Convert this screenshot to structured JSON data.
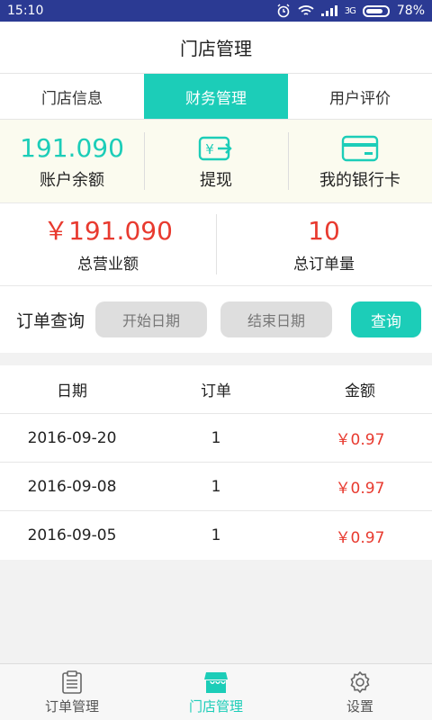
{
  "status_bar": {
    "time": "15:10",
    "network": "3G",
    "battery": "78%"
  },
  "header": {
    "title": "门店管理"
  },
  "tabs": [
    {
      "label": "门店信息",
      "active": false
    },
    {
      "label": "财务管理",
      "active": true
    },
    {
      "label": "用户评价",
      "active": false
    }
  ],
  "balance": {
    "amount": "191.090",
    "amount_label": "账户余额",
    "withdraw_label": "提现",
    "bank_card_label": "我的银行卡"
  },
  "stats": {
    "revenue_value": "￥191.090",
    "revenue_label": "总营业额",
    "orders_value": "10",
    "orders_label": "总订单量"
  },
  "query": {
    "label": "订单查询",
    "start_date": "开始日期",
    "end_date": "结束日期",
    "button": "查询"
  },
  "table": {
    "headers": [
      "日期",
      "订单",
      "金额"
    ],
    "rows": [
      {
        "date": "2016-09-20",
        "orders": "1",
        "amount": "￥0.97"
      },
      {
        "date": "2016-09-08",
        "orders": "1",
        "amount": "￥0.97"
      },
      {
        "date": "2016-09-05",
        "orders": "1",
        "amount": "￥0.97"
      }
    ]
  },
  "bottom_nav": [
    {
      "label": "订单管理",
      "icon": "clipboard-icon",
      "active": false
    },
    {
      "label": "门店管理",
      "icon": "store-icon",
      "active": true
    },
    {
      "label": "设置",
      "icon": "gear-icon",
      "active": false
    }
  ],
  "colors": {
    "accent": "#1ccdb8",
    "money": "#e83a2f",
    "status_bar": "#2b3a93"
  }
}
